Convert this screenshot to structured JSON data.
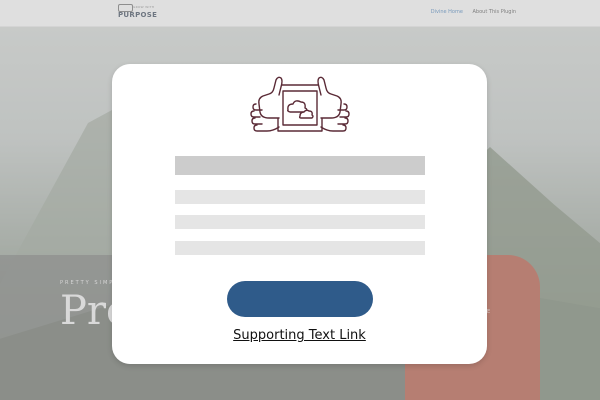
{
  "header": {
    "logo": {
      "tagline": "GROW WITH",
      "wordmark": "PURPOSE"
    },
    "nav": [
      {
        "label": "Divine Home",
        "active": true
      },
      {
        "label": "About This Plugin",
        "active": false
      }
    ]
  },
  "hero": {
    "kicker": "PRETTY SIMPLE",
    "title": "Pre",
    "side_text": "E"
  },
  "modal": {
    "illustration_icon": "thumbs-up-holding-photo-icon",
    "title_placeholder": "",
    "body_placeholders": [
      "",
      "",
      ""
    ],
    "cta_label": "",
    "link_text": "Supporting Text Link"
  },
  "colors": {
    "cta": "#2f5b8a",
    "orange": "#b04a34",
    "nav_active": "#3d7ab8"
  }
}
